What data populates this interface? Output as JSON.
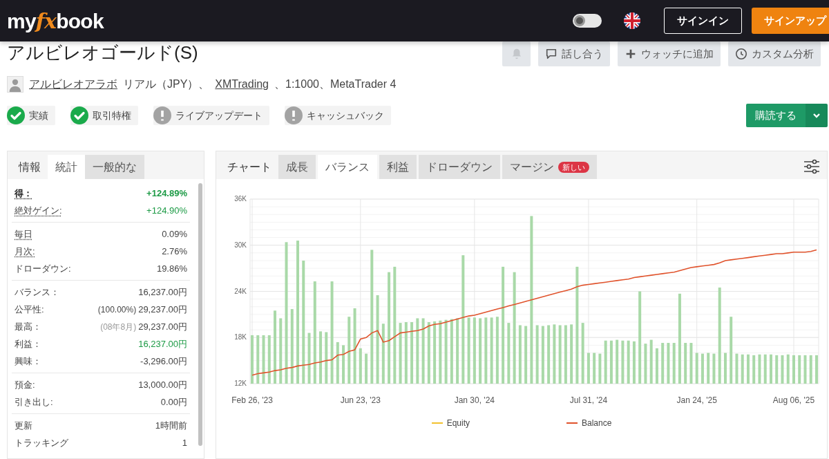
{
  "header": {
    "logo": {
      "lead": "my",
      "accent": "fx",
      "tail": "book"
    },
    "theme_toggle": {
      "on": false
    },
    "sign_in": "サインイン",
    "sign_up": "サインアップ"
  },
  "title": "アルビレオゴールド(S)",
  "actions": [
    {
      "kind": "bell"
    },
    {
      "kind": "chat",
      "label": "話し合う"
    },
    {
      "kind": "plus",
      "label": "ウォッチに追加"
    },
    {
      "kind": "clock",
      "label": "カスタム分析"
    }
  ],
  "owner": [
    {
      "kind": "link",
      "text": "アルビレオアラボ"
    },
    {
      "kind": "text",
      "text": "リアル（JPY）、"
    },
    {
      "kind": "link",
      "text": "XMTrading"
    },
    {
      "kind": "text",
      "text": "、1:1000、MetaTrader 4"
    }
  ],
  "badges": [
    {
      "label": "実績",
      "verified": true
    },
    {
      "label": "取引特権",
      "verified": true
    },
    {
      "label": "ライブアップデート",
      "verified": false
    },
    {
      "label": "キャッシュバック",
      "verified": false
    }
  ],
  "subscribe": {
    "label": "購読する"
  },
  "stats_panel": {
    "heading": "情報",
    "tabs": [
      {
        "label": "統計",
        "selected": true
      },
      {
        "label": "一般的な",
        "selected": false
      }
    ],
    "groups": [
      [
        {
          "label": "得：",
          "bold": true,
          "underlined": true,
          "value": "+124.89%",
          "positive": true
        },
        {
          "label": "絶対ゲイン:",
          "bold": false,
          "underlined": true,
          "value": "+124.90%",
          "positive": true
        }
      ],
      [
        {
          "label": "毎日",
          "bold": false,
          "underlined": true,
          "value": "0.09%",
          "positive": false
        },
        {
          "label": "月次:",
          "bold": false,
          "underlined": true,
          "value": "2.76%",
          "positive": false
        },
        {
          "label": "ドローダウン:",
          "bold": false,
          "underlined": false,
          "value": "19.86%",
          "positive": false
        }
      ],
      [
        {
          "label": "バランス：",
          "bold": false,
          "underlined": false,
          "value": "16,237.00円",
          "positive": false
        },
        {
          "label": "公平性:",
          "bold": false,
          "underlined": false,
          "note": "(100.00%)",
          "note_muted": false,
          "value": "29,237.00円",
          "positive": false
        },
        {
          "label": "最高：",
          "bold": false,
          "underlined": false,
          "note": "(08年8月)",
          "note_muted": true,
          "value": "29,237.00円",
          "positive": false
        },
        {
          "label": "利益：",
          "bold": false,
          "underlined": false,
          "value": "16,237.00円",
          "positive": true
        },
        {
          "label": "興味：",
          "bold": false,
          "underlined": false,
          "value": "-3,296.00円",
          "positive": false
        }
      ],
      [
        {
          "label": "預金:",
          "bold": false,
          "underlined": false,
          "value": "13,000.00円",
          "positive": false
        },
        {
          "label": "引き出し:",
          "bold": false,
          "underlined": false,
          "value": "0.00円",
          "positive": false
        }
      ],
      [
        {
          "label": "更新",
          "bold": false,
          "underlined": false,
          "value": "1時間前",
          "positive": false
        },
        {
          "label": "トラッキング",
          "bold": false,
          "underlined": false,
          "value": "1",
          "positive": false
        }
      ]
    ]
  },
  "chart_panel": {
    "heading": "チャート",
    "tabs": [
      {
        "label": "成長",
        "selected": false
      },
      {
        "label": "バランス",
        "selected": true
      },
      {
        "label": "利益",
        "selected": false
      },
      {
        "label": "ドローダウン",
        "selected": false
      },
      {
        "label": "マージン",
        "selected": false,
        "badge": "新しい"
      }
    ],
    "chart_data": {
      "type": "line",
      "grid": true,
      "legend": "bottom",
      "categories": [
        "Feb 26, '23",
        null,
        null,
        null,
        null,
        null,
        null,
        null,
        null,
        null,
        null,
        null,
        null,
        null,
        null,
        null,
        null,
        null,
        null,
        "Jun 23, '23",
        null,
        null,
        null,
        null,
        null,
        null,
        null,
        null,
        null,
        null,
        null,
        null,
        null,
        null,
        null,
        null,
        null,
        null,
        null,
        "Jan 30, '24",
        null,
        null,
        null,
        null,
        null,
        null,
        null,
        null,
        null,
        null,
        null,
        null,
        null,
        null,
        null,
        null,
        null,
        null,
        null,
        "Jul 31, '24",
        null,
        null,
        null,
        null,
        null,
        null,
        null,
        null,
        null,
        null,
        null,
        null,
        null,
        null,
        null,
        null,
        null,
        null,
        "Jan 24, '25",
        null,
        null,
        null,
        null,
        null,
        null,
        null,
        null,
        null,
        null,
        null,
        null,
        null,
        null,
        null,
        null,
        "Aug 06, '25",
        null,
        null,
        null,
        null
      ],
      "ylim": [
        12,
        36
      ],
      "yticks": [
        {
          "value": 12,
          "label": "12K"
        },
        {
          "value": 18,
          "label": "18K"
        },
        {
          "value": 24,
          "label": "24K"
        },
        {
          "value": 30,
          "label": "30K"
        },
        {
          "value": 36,
          "label": "36K"
        }
      ],
      "series": [
        {
          "type": "bar",
          "color": "#a9d9a8",
          "values": [
            18.3,
            18.3,
            18.3,
            18.3,
            21.5,
            20.5,
            30.4,
            21.7,
            30.6,
            28.0,
            18.6,
            25.3,
            18.8,
            18.7,
            25.3,
            17.4,
            17.0,
            20.7,
            21.8,
            16.6,
            15.9,
            29.4,
            23.5,
            19.8,
            26.5,
            27.2,
            19.9,
            20.0,
            20.0,
            20.5,
            20.5,
            20.0,
            20.1,
            20.2,
            20.3,
            20.4,
            20.5,
            28.7,
            20.6,
            20.6,
            20.5,
            20.6,
            20.6,
            20.7,
            27.2,
            19.9,
            26.5,
            19.6,
            19.5,
            33.8,
            19.6,
            19.5,
            19.6,
            19.7,
            19.6,
            19.6,
            19.7,
            27.2,
            19.9,
            16.0,
            16.0,
            15.9,
            17.6,
            17.6,
            17.7,
            17.6,
            17.6,
            17.5,
            24.0,
            17.2,
            17.7,
            16.6,
            17.3,
            17.3,
            17.3,
            23.7,
            17.3,
            17.3,
            16.0,
            15.9,
            16.0,
            15.9,
            24.5,
            16.0,
            20.7,
            15.9,
            15.8,
            15.8,
            15.7,
            15.8,
            15.8,
            15.8,
            15.7,
            15.7,
            15.8,
            15.7,
            15.7,
            15.7,
            15.7,
            15.7
          ]
        },
        {
          "name": "Equity",
          "type": "line",
          "color": "#f2c12e",
          "values": [
            null,
            null,
            null,
            null,
            null,
            null,
            null,
            null,
            null,
            null,
            null,
            null,
            null,
            null,
            null,
            null,
            null,
            null,
            null,
            null,
            null,
            null,
            null,
            null,
            null,
            null,
            null,
            null,
            null,
            null,
            null,
            null,
            null,
            null,
            null,
            null,
            null,
            null,
            null,
            null,
            null,
            null,
            null,
            null,
            null,
            null,
            null,
            null,
            null,
            null,
            null,
            null,
            null,
            null,
            null,
            null,
            null,
            null,
            null,
            null,
            null,
            null,
            null,
            null,
            null,
            null,
            null,
            null,
            null,
            null,
            null,
            null,
            null,
            null,
            null,
            null,
            null,
            null,
            null,
            null,
            null,
            null,
            null,
            null,
            null,
            null,
            null,
            null,
            null,
            null,
            null,
            null,
            null,
            null,
            null,
            null,
            null,
            null,
            null,
            null
          ]
        },
        {
          "name": "Balance",
          "type": "line",
          "color": "#e0522b",
          "values": [
            13.1,
            13.3,
            13.4,
            13.5,
            13.7,
            13.8,
            14.0,
            14.1,
            14.3,
            14.4,
            14.5,
            14.7,
            14.8,
            15.0,
            15.1,
            15.7,
            15.8,
            16.2,
            16.4,
            17.8,
            18.0,
            18.6,
            18.9,
            17.4,
            17.6,
            18.1,
            18.6,
            18.7,
            18.8,
            18.9,
            19.1,
            19.5,
            19.7,
            19.8,
            20.0,
            20.2,
            20.4,
            20.6,
            20.8,
            20.9,
            21.1,
            21.3,
            21.5,
            21.7,
            21.9,
            22.1,
            22.3,
            22.5,
            22.7,
            22.9,
            23.1,
            23.3,
            23.5,
            23.7,
            23.9,
            24.1,
            24.3,
            24.6,
            24.8,
            24.9,
            25.0,
            25.1,
            25.2,
            25.3,
            25.4,
            25.5,
            25.6,
            25.8,
            25.9,
            26.0,
            26.1,
            26.2,
            26.3,
            26.4,
            26.5,
            26.7,
            26.9,
            27.1,
            27.2,
            27.3,
            27.4,
            27.5,
            27.7,
            28.0,
            28.1,
            28.2,
            28.3,
            28.4,
            28.5,
            28.6,
            28.7,
            28.8,
            28.9,
            28.9,
            29.0,
            29.1,
            29.1,
            29.1,
            29.2,
            29.4
          ]
        }
      ]
    }
  }
}
